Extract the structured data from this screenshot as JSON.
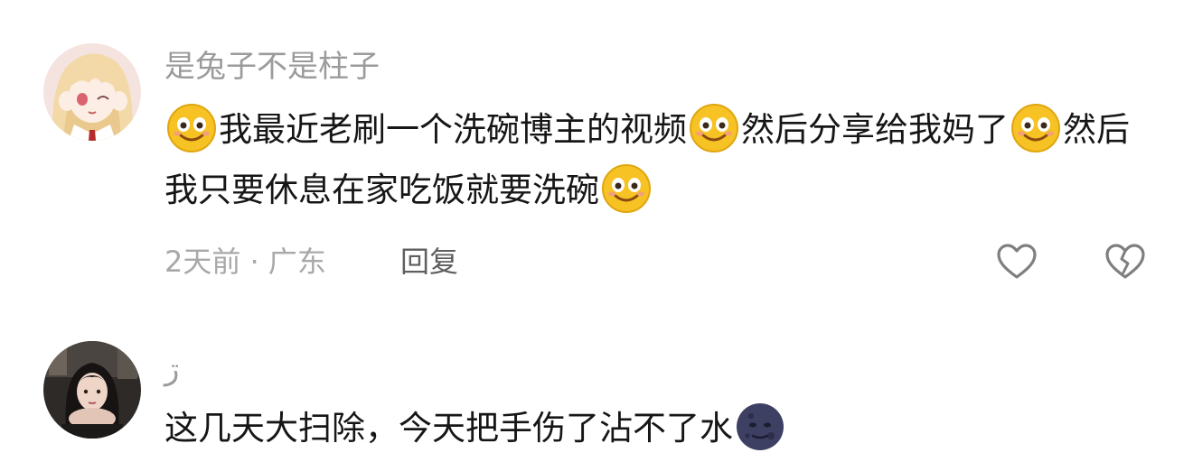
{
  "comments": [
    {
      "username": "是兔子不是柱子",
      "segments": [
        "我最近老刷一个洗碗博主的视频",
        "然后分享给我妈了",
        "然后我只要休息在家吃饭就要洗碗",
        ""
      ],
      "emoji": "smiling-face-emoji",
      "time_location": "2天前 · 广东",
      "reply_label": "回复",
      "like_icon": "heart-outline-icon",
      "dislike_icon": "broken-heart-icon"
    },
    {
      "username": "ڗ",
      "text": "这几天大扫除，今天把手伤了沾不了水",
      "emoji": "new-moon-face-emoji"
    }
  ],
  "colors": {
    "username": "#9b9b9b",
    "body": "#161616",
    "meta": "#a8a8a8",
    "reply": "#5f5f5f",
    "emoji_yellow": "#f7c223",
    "moon": "#3d3f63"
  }
}
